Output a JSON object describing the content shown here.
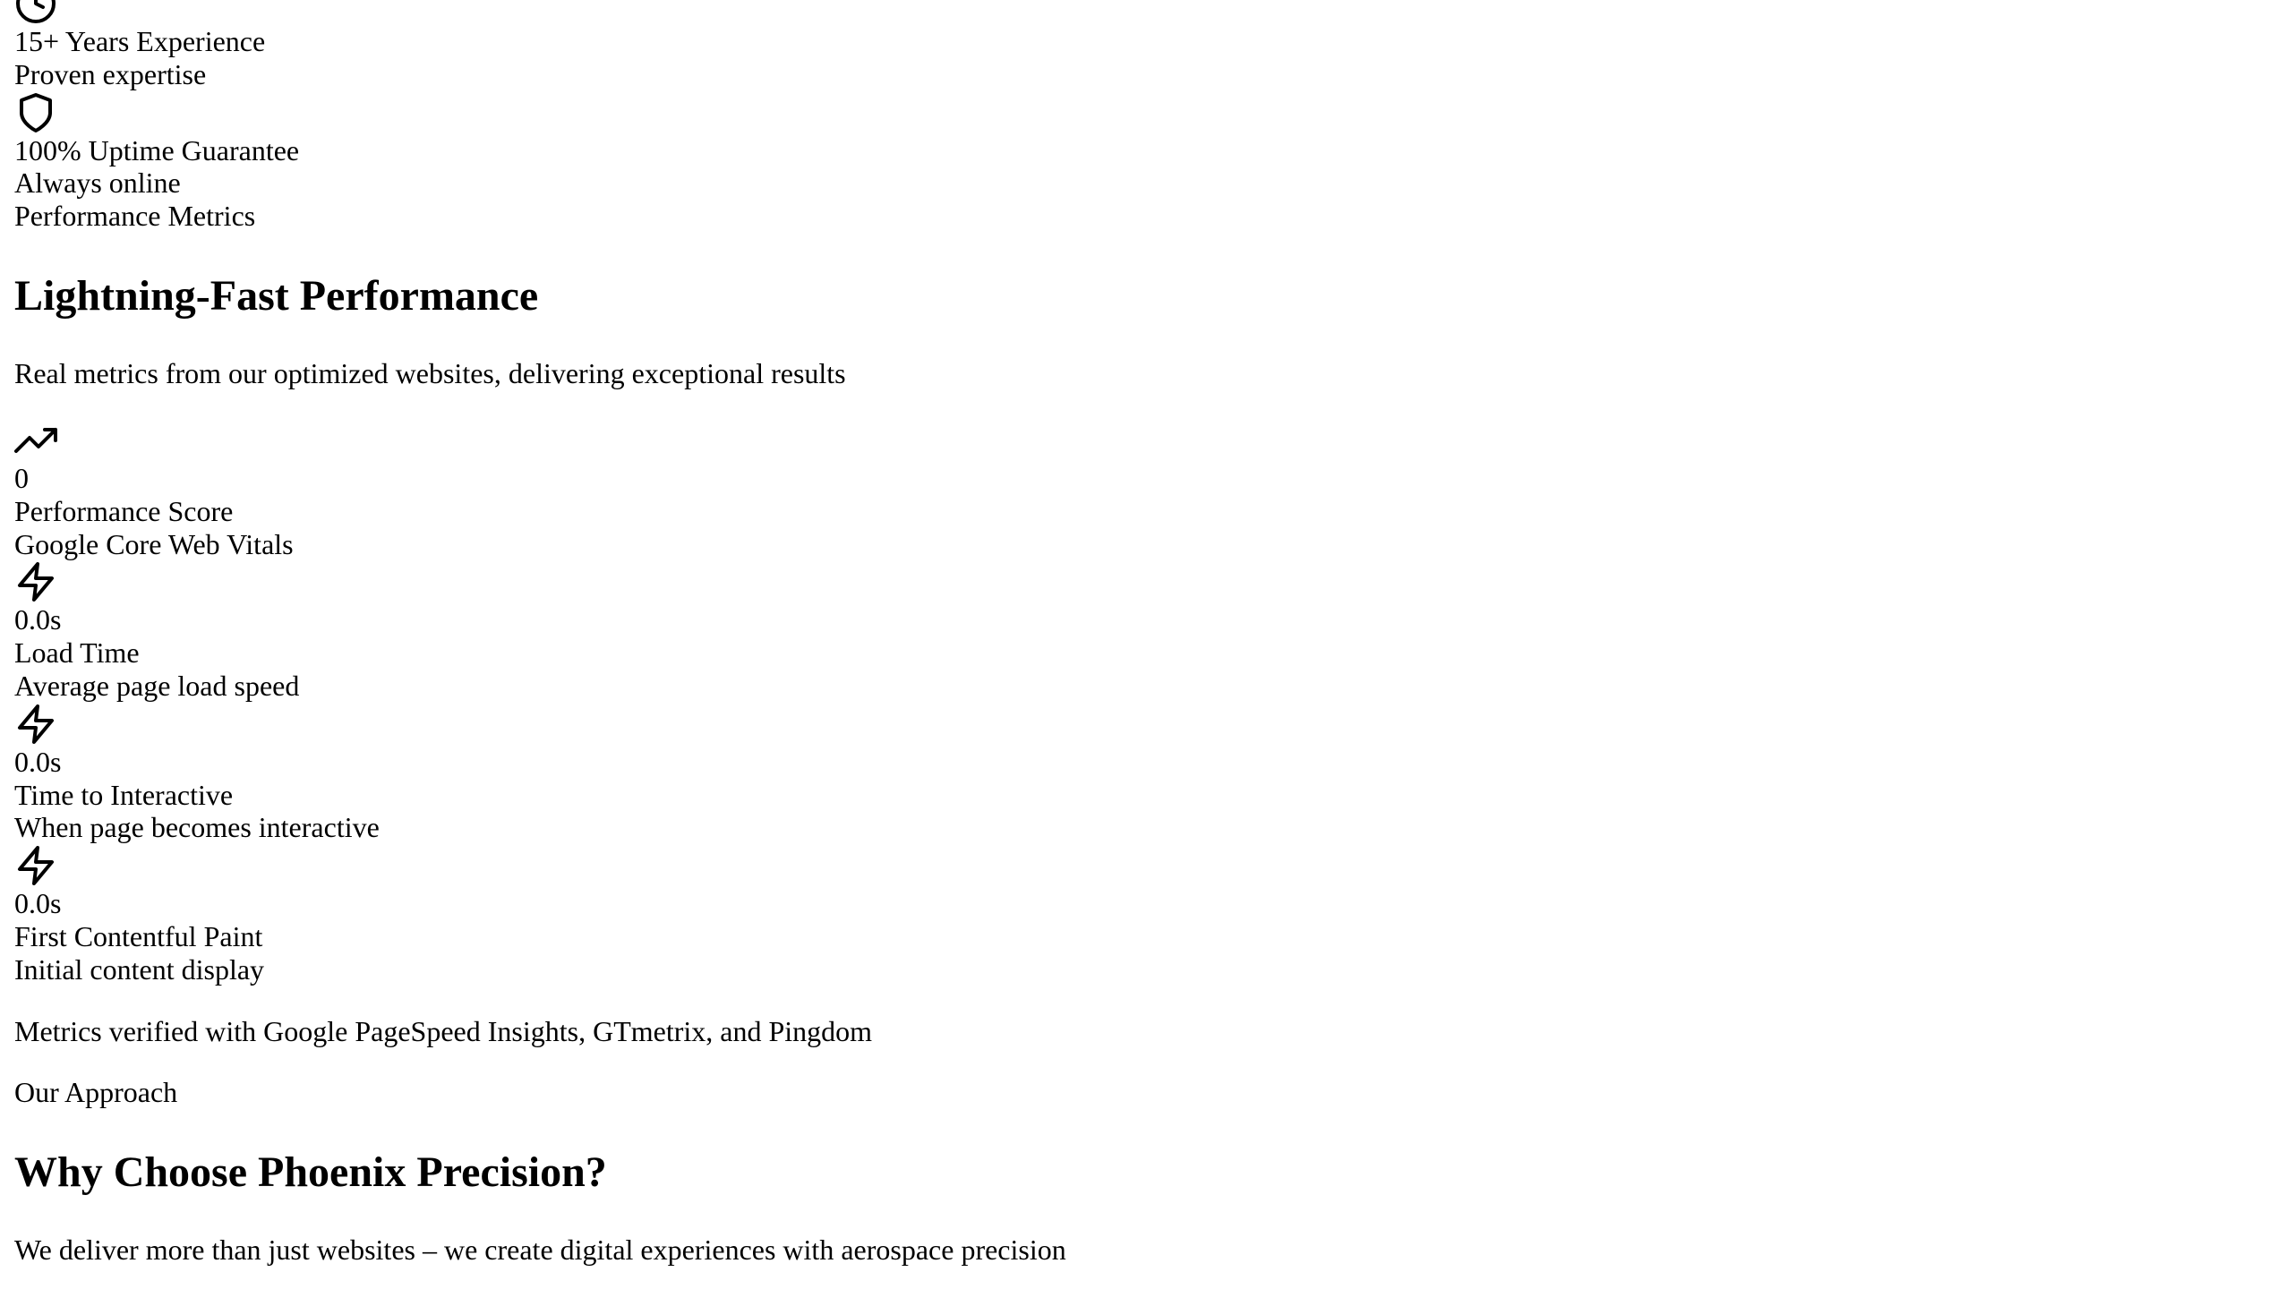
{
  "features": [
    {
      "icon": "clock-icon",
      "title": "15+ Years Experience",
      "subtitle": "Proven expertise"
    },
    {
      "icon": "shield-icon",
      "title": "100% Uptime Guarantee",
      "subtitle": "Always online"
    }
  ],
  "performance": {
    "eyebrow": "Performance Metrics",
    "heading": "Lightning-Fast Performance",
    "subheading": "Real metrics from our optimized websites, delivering exceptional results",
    "metrics": [
      {
        "icon": "trending-up-icon",
        "value": "0",
        "label": "Performance Score",
        "desc": "Google Core Web Vitals"
      },
      {
        "icon": "lightning-icon",
        "value": "0.0s",
        "label": "Load Time",
        "desc": "Average page load speed"
      },
      {
        "icon": "lightning-icon",
        "value": "0.0s",
        "label": "Time to Interactive",
        "desc": "When page becomes interactive"
      },
      {
        "icon": "lightning-icon",
        "value": "0.0s",
        "label": "First Contentful Paint",
        "desc": "Initial content display"
      }
    ],
    "verification": "Metrics verified with Google PageSpeed Insights, GTmetrix, and Pingdom"
  },
  "approach": {
    "eyebrow": "Our Approach",
    "heading": "Why Choose Phoenix Precision?",
    "subheading": "We deliver more than just websites – we create digital experiences with aerospace precision"
  }
}
